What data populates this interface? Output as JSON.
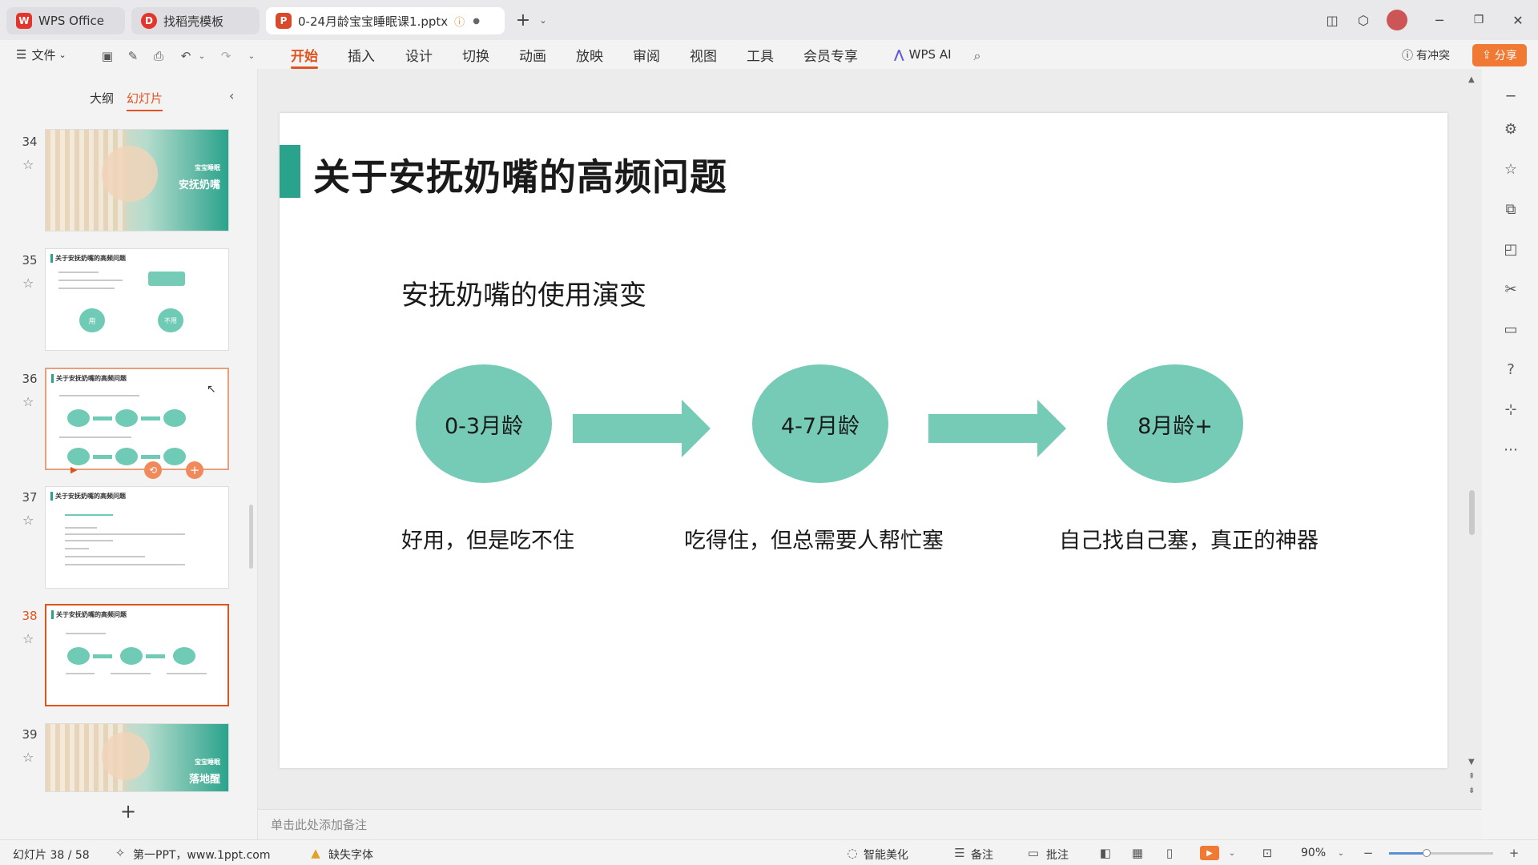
{
  "titlebar": {
    "tabs": [
      {
        "label": "WPS Office",
        "logo": "W"
      },
      {
        "label": "找稻壳模板",
        "logo": "D"
      },
      {
        "label": "0-24月龄宝宝睡眠课1.pptx",
        "logo": "P"
      }
    ],
    "new_tab": "+",
    "colors": {
      "wps_red": "#e2352b",
      "ppt_red": "#d94a2a",
      "accent_orange": "#e0531f"
    }
  },
  "menubar": {
    "file_label": "文件",
    "items": [
      "开始",
      "插入",
      "设计",
      "切换",
      "动画",
      "放映",
      "审阅",
      "视图",
      "工具",
      "会员专享"
    ],
    "active_item": "开始",
    "wps_ai": "WPS AI",
    "conflict": "有冲突",
    "share": "分享"
  },
  "leftpanel": {
    "tab_outline": "大纲",
    "tab_slides": "幻灯片",
    "thumbnails": [
      {
        "num": "34",
        "kind": "photo",
        "text": "安抚奶嘴",
        "small": "宝宝睡眠"
      },
      {
        "num": "35",
        "kind": "text",
        "title": "关于安抚奶嘴的高频问题",
        "c1": "用",
        "c2": "不用"
      },
      {
        "num": "36",
        "kind": "flow2",
        "title": "关于安抚奶嘴的高频问题"
      },
      {
        "num": "37",
        "kind": "text2",
        "title": "关于安抚奶嘴的高频问题"
      },
      {
        "num": "38",
        "kind": "flow",
        "title": "关于安抚奶嘴的高频问题"
      },
      {
        "num": "39",
        "kind": "photo",
        "text": "落地醒",
        "small": "宝宝睡眠"
      }
    ],
    "add_label": "+"
  },
  "slide": {
    "title": "关于安抚奶嘴的高频问题",
    "subtitle": "安抚奶嘴的使用演变",
    "stages": [
      {
        "label": "0-3月龄",
        "desc": "好用，但是吃不住"
      },
      {
        "label": "4-7月龄",
        "desc": "吃得住，但总需要人帮忙塞"
      },
      {
        "label": "8月龄+",
        "desc": "自己找自己塞，真正的神器"
      }
    ],
    "accent_color": "#2aa38c",
    "circle_color": "#76cbb7"
  },
  "notes_placeholder": "单击此处添加备注",
  "statusbar": {
    "slide_info": "幻灯片 38 / 58",
    "theme": "第一PPT，www.1ppt.com",
    "missing_font": "缺失字体",
    "beautify": "智能美化",
    "notes": "备注",
    "comment": "批注",
    "zoom": "90%",
    "zoom_level": 0.36
  }
}
